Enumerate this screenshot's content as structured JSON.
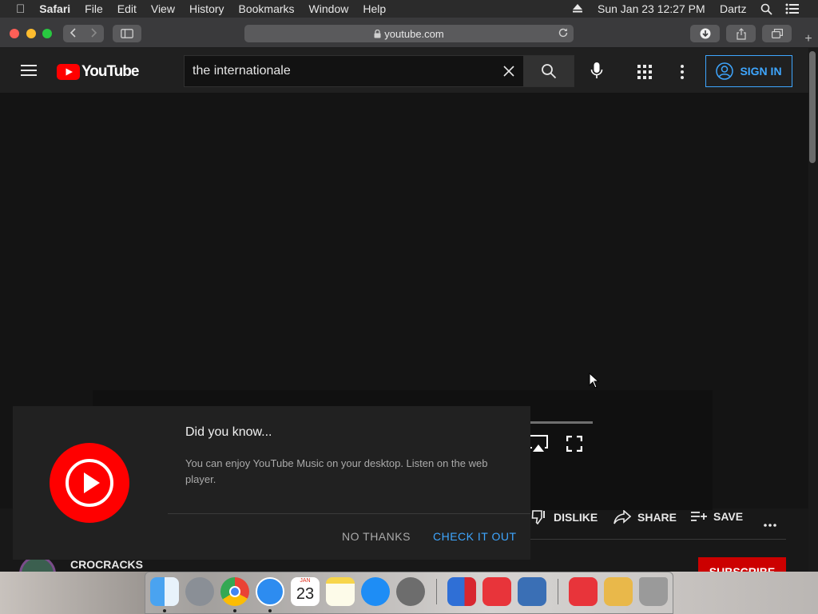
{
  "menubar": {
    "app": "Safari",
    "items": [
      "File",
      "Edit",
      "View",
      "History",
      "Bookmarks",
      "Window",
      "Help"
    ],
    "datetime": "Sun Jan 23  12:27 PM",
    "user": "Dartz"
  },
  "browser": {
    "url": "youtube.com"
  },
  "youtube": {
    "logo_text": "YouTube",
    "search_value": "the internationale",
    "sign_in": "SIGN IN",
    "actions": {
      "dislike": "DISLIKE",
      "share": "SHARE",
      "save": "SAVE"
    },
    "channel_name": "CROCRACKS",
    "subscribe": "SUBSCRIBE"
  },
  "popup": {
    "title": "Did you know...",
    "body": "You can enjoy YouTube Music on your desktop. Listen on the web player.",
    "no_thanks": "NO THANKS",
    "check_it_out": "CHECK IT OUT"
  },
  "dock": {
    "calendar_month": "JAN",
    "calendar_day": "23"
  },
  "colors": {
    "brand_red": "#ff0000",
    "accent_blue": "#3ea6ff",
    "subscribe_red": "#cc0000"
  }
}
